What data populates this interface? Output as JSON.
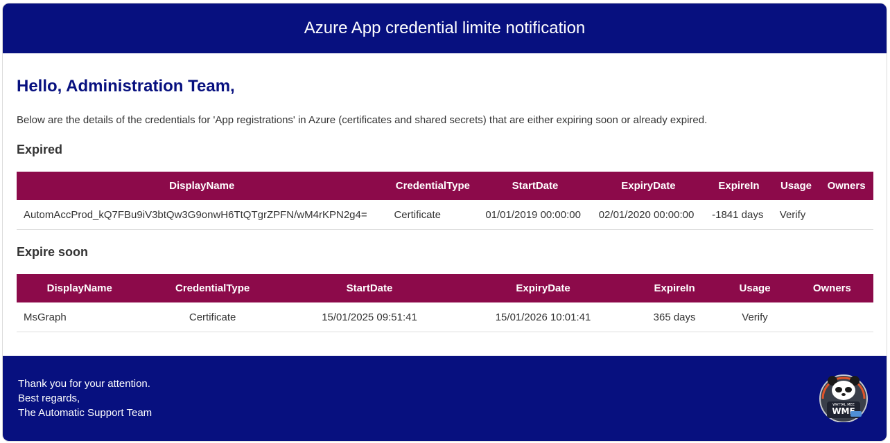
{
  "header": {
    "title": "Azure App credential limite notification"
  },
  "greeting": "Hello, Administration Team,",
  "intro": "Below are the details of the credentials for 'App registrations' in Azure (certificates and shared secrets) that are either expiring soon or already expired.",
  "columns": [
    "DisplayName",
    "CredentialType",
    "StartDate",
    "ExpiryDate",
    "ExpireIn",
    "Usage",
    "Owners"
  ],
  "expired": {
    "title": "Expired",
    "rows": [
      [
        "AutomAccProd_kQ7FBu9iV3btQw3G9onwH6TtQTgrZPFN/wM4rKPN2g4=",
        "Certificate",
        "01/01/2019 00:00:00",
        "02/01/2020 00:00:00",
        "-1841 days",
        "Verify",
        ""
      ]
    ]
  },
  "expire_soon": {
    "title": "Expire soon",
    "rows": [
      [
        "MsGraph",
        "Certificate",
        "15/01/2025 09:51:41",
        "15/01/2026 10:01:41",
        "365 days",
        "Verify",
        ""
      ]
    ]
  },
  "footer": {
    "lines": [
      "Thank you for your attention.",
      "Best regards,",
      "The Automatic Support Team"
    ],
    "logo_text": "WME",
    "logo_small_text": "WATTAL MEE"
  },
  "colors": {
    "header_bg": "#07107f",
    "table_header_bg": "#8c0a4a",
    "greeting": "#07107f"
  }
}
